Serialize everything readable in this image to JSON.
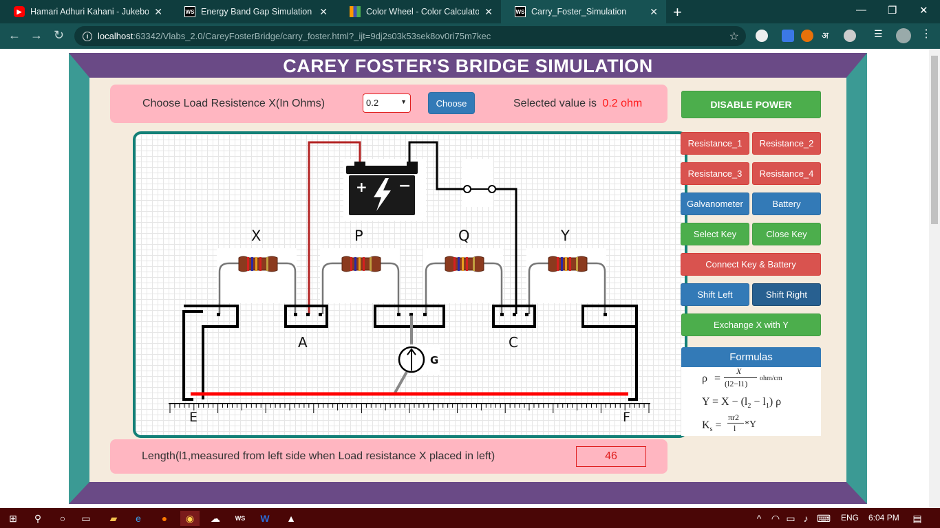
{
  "browser": {
    "tabs": [
      {
        "title": "Hamari Adhuri Kahani - Jukebox",
        "icon": "youtube-icon",
        "active": false
      },
      {
        "title": "Energy Band Gap Simulation",
        "icon": "webstorm-icon",
        "active": false
      },
      {
        "title": "Color Wheel - Color Calculator | S",
        "icon": "color-wheel-icon",
        "active": false
      },
      {
        "title": "Carry_Foster_Simulation",
        "icon": "webstorm-icon",
        "active": true
      }
    ],
    "url_host": "localhost",
    "url_path": ":63342/Vlabs_2.0/CareyFosterBridge/carry_foster.html?_ijt=9dj2s03k53sek8ov0ri75m7kec"
  },
  "page": {
    "title": "CAREY FOSTER'S BRIDGE SIMULATION",
    "choose_label": "Choose Load Resistence X(In Ohms)",
    "select_value": "0.2",
    "choose_button": "Choose",
    "selected_prefix": "Selected value is",
    "selected_value": "0.2 ohm",
    "length_label": "Length(l1,measured from left side when Load resistance X placed in left)",
    "length_value": "46"
  },
  "circuit": {
    "resistor_labels": [
      "X",
      "P",
      "Q",
      "Y"
    ],
    "node_labels": [
      "A",
      "C"
    ],
    "end_labels": [
      "E",
      "F"
    ],
    "galvanometer_label": "G"
  },
  "controls": {
    "power": "DISABLE POWER",
    "resistance_1": "Resistance_1",
    "resistance_2": "Resistance_2",
    "resistance_3": "Resistance_3",
    "resistance_4": "Resistance_4",
    "galvanometer": "Galvanometer",
    "battery": "Battery",
    "select_key": "Select Key",
    "close_key": "Close Key",
    "connect": "Connect Key & Battery",
    "shift_left": "Shift Left",
    "shift_right": "Shift Right",
    "exchange": "Exchange X with Y",
    "formulas": "Formulas"
  },
  "formulas": {
    "rho_sym": "ρ",
    "rho_num": "X",
    "rho_den": "(l2−l1)",
    "rho_unit": "ohm/cm",
    "y_line": "Y  = X − (l",
    "y_tail": ") ρ",
    "ks_sym": "K",
    "ks_num": "πr2",
    "ks_den": "l",
    "ks_tail": "*Y"
  },
  "taskbar": {
    "lang": "ENG",
    "time": "6:04 PM"
  },
  "colors": {
    "frame_teal": "#3b9a94",
    "frame_purple": "#6a4a86",
    "panel_cream": "#f5ebdd",
    "pink": "#ffb6c1",
    "wire_red": "#ff0000"
  }
}
